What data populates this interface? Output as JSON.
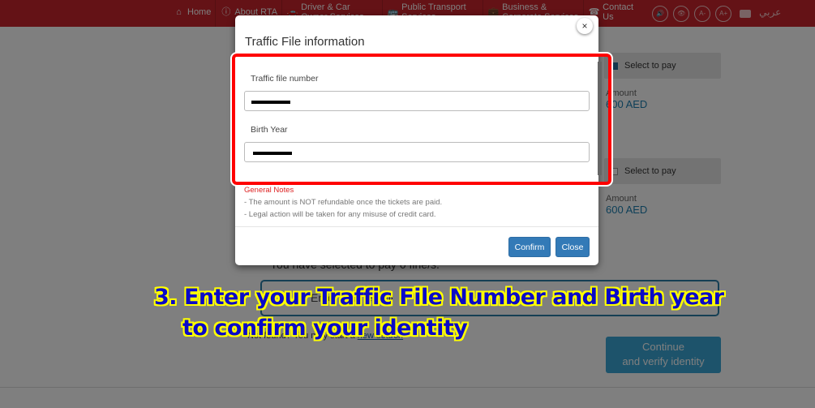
{
  "nav": {
    "items": [
      {
        "label": "Home",
        "icon": "home-icon"
      },
      {
        "label": "About RTA",
        "icon": "info-icon"
      },
      {
        "label": "Driver & Car Owner Services",
        "icon": "car-icon"
      },
      {
        "label": "Public Transport Services",
        "icon": "bus-icon"
      },
      {
        "label": "Business & Corporate Services",
        "icon": "briefcase-icon"
      },
      {
        "label": "Contact Us",
        "icon": "phone-icon"
      }
    ],
    "accessibility": {
      "sound": "🔊",
      "view": "👁",
      "font_smaller": "A-",
      "font_larger": "A+",
      "language": "عربي"
    }
  },
  "background_page": {
    "pay_cards": [
      {
        "select_label": "Select to pay",
        "amount_label": "Amount",
        "amount": "600 AED"
      },
      {
        "select_label": "Select to pay",
        "amount_label": "Amount",
        "amount": "600 AED"
      }
    ],
    "selected_summary": "You have selected to pay 0 fine/s.",
    "field_text": "Enter your email",
    "new_search_prefix": "Not found? You may start a",
    "new_search_link": "new search",
    "continue_button": "Continue\nand verify identity"
  },
  "modal": {
    "title": "Traffic File information",
    "close_symbol": "×",
    "fields": [
      {
        "label": "Traffic file number",
        "value": "[redacted]"
      },
      {
        "label": "Birth Year",
        "value": "[redacted]"
      }
    ],
    "notes_title": "General Notes",
    "notes": [
      "- The amount is NOT refundable once the tickets are paid.",
      "- Legal action will be taken for any misuse of credit card."
    ],
    "confirm_label": "Confirm",
    "close_label": "Close"
  },
  "caption": {
    "line1": "3. Enter your Traffic File Number and Birth year",
    "line2": "to confirm your identity"
  },
  "colors": {
    "nav_red": "#c8252c",
    "button_blue": "#337ab7",
    "highlight_red": "#ff0000",
    "caption_blue": "#0a0ac8",
    "caption_outline": "#ffff00",
    "amount_blue": "#1c7fb0"
  }
}
